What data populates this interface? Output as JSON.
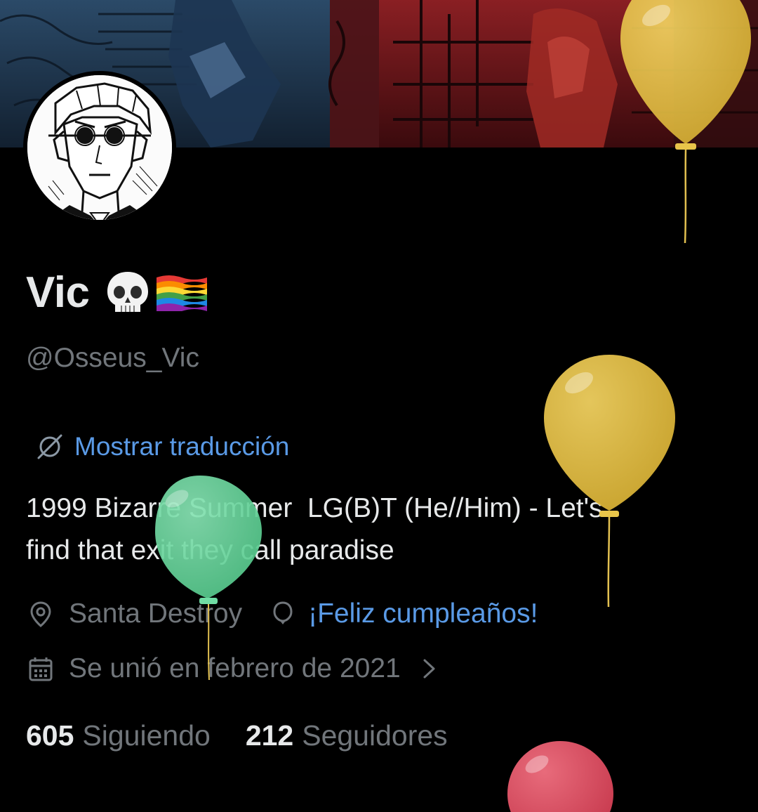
{
  "profile": {
    "display_name": "Vic",
    "handle": "@Osseus_Vic",
    "name_emojis": [
      "skull-icon",
      "rainbow-flag-icon"
    ]
  },
  "translate": {
    "label": "Mostrar traducción"
  },
  "bio": {
    "text": "1999 Bizarre Summer  LG(B)T (He//Him) - Let's\nfind that exit they call paradise"
  },
  "meta": {
    "location": "Santa Destroy",
    "birthday": "¡Feliz cumpleaños!",
    "joined": "Se unió en febrero de 2021"
  },
  "counts": {
    "following": {
      "value": "605",
      "label": "Siguiendo"
    },
    "followers": {
      "value": "212",
      "label": "Seguidores"
    }
  },
  "colors": {
    "background": "#000000",
    "text_primary": "#e7e9ea",
    "text_secondary": "#71767b",
    "link": "#5a9ae6",
    "balloon_yellow": "#e2bd3d",
    "balloon_green": "#66d49a",
    "balloon_red": "#d94d5f"
  }
}
